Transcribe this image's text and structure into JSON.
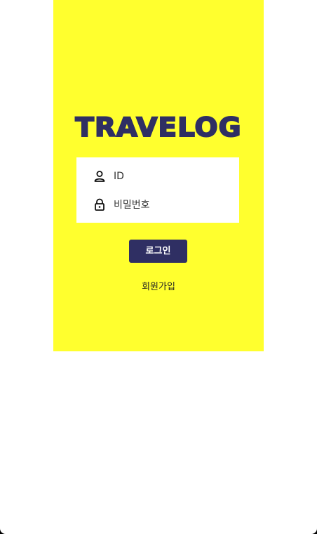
{
  "app": {
    "logo_text": "TRAVELOG"
  },
  "login_form": {
    "id_placeholder": "ID",
    "password_placeholder": "비밀번호",
    "id_icon": "user-icon",
    "password_icon": "lock-icon"
  },
  "actions": {
    "login_label": "로그인",
    "signup_label": "회원가입"
  },
  "colors": {
    "panel_background": "#ffff2e",
    "brand_navy": "#2f2f63",
    "form_background": "#ffffff"
  }
}
